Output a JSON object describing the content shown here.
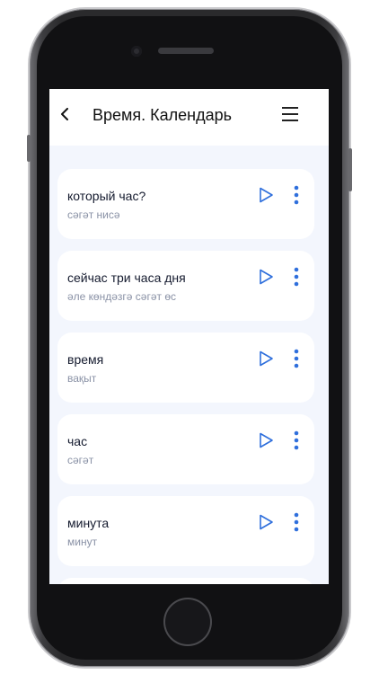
{
  "header": {
    "title": "Время. Календарь",
    "back_icon": "chevron-left-icon",
    "menu_icon": "hamburger-menu-icon"
  },
  "accent_color": "#2f6fdc",
  "items": [
    {
      "ru": "который час?",
      "tt": "сәгәт нисә"
    },
    {
      "ru": "сейчас три часа дня",
      "tt": "әле көндәзгә сәгәт өс"
    },
    {
      "ru": "время",
      "tt": "вақыт"
    },
    {
      "ru": "час",
      "tt": "сәгәт"
    },
    {
      "ru": "минута",
      "tt": "минут"
    }
  ]
}
